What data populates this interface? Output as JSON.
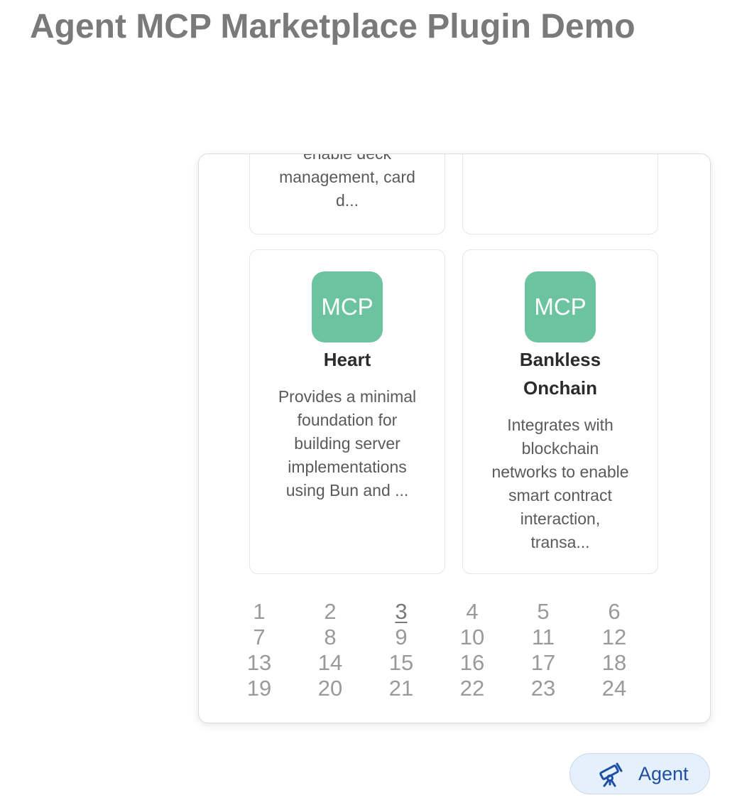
{
  "page": {
    "title": "Agent MCP Marketplace Plugin Demo"
  },
  "cards_cut": [
    {
      "desc_lines": [
        "enable deck",
        "management, card",
        "d..."
      ]
    },
    {
      "desc_lines": []
    }
  ],
  "cards": [
    {
      "icon_text": "MCP",
      "name_lines": [
        "Heart"
      ],
      "desc_lines": [
        "Provides a minimal",
        "foundation for",
        "building server",
        "implementations",
        "using Bun and ..."
      ]
    },
    {
      "icon_text": "MCP",
      "name_lines": [
        "Bankless",
        "Onchain"
      ],
      "desc_lines": [
        "Integrates with",
        "blockchain",
        "networks to enable",
        "smart contract",
        "interaction,",
        "transa..."
      ]
    }
  ],
  "pagination": {
    "pages": [
      "1",
      "2",
      "3",
      "4",
      "5",
      "6",
      "7",
      "8",
      "9",
      "10",
      "11",
      "12",
      "13",
      "14",
      "15",
      "16",
      "17",
      "18",
      "19",
      "20",
      "21",
      "22",
      "23",
      "24"
    ],
    "current": "3"
  },
  "agent_button": {
    "label": "Agent",
    "icon": "telescope-icon"
  },
  "colors": {
    "icon_bg": "#6cc39f",
    "agent_text": "#1e4fa3",
    "agent_bg": "#e4f0fb",
    "title": "#7a7a7a"
  }
}
